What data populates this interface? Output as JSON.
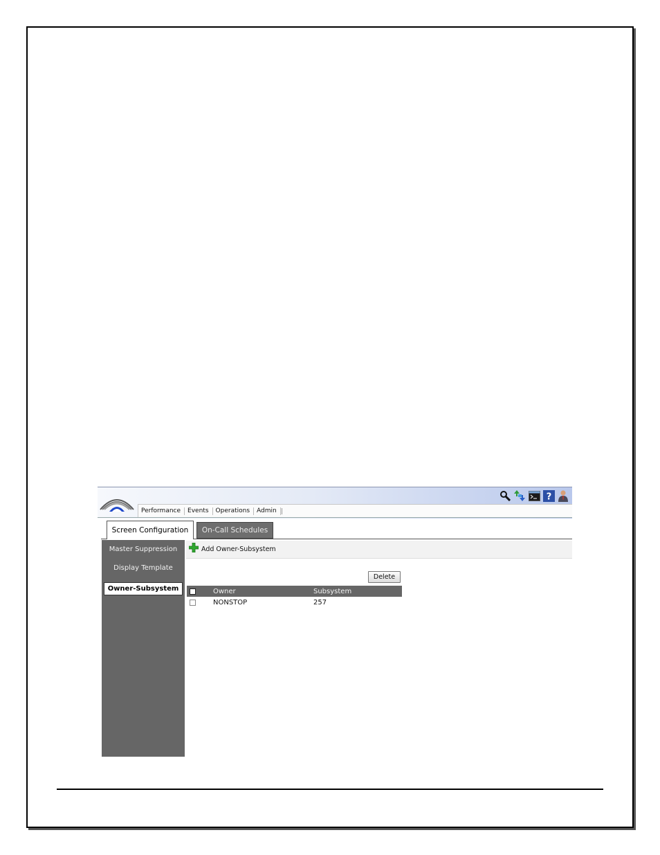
{
  "menu": {
    "items": [
      "Performance",
      "Events",
      "Operations",
      "Admin"
    ]
  },
  "top_icons": [
    "search-icon",
    "refresh-arrows-icon",
    "terminal-icon",
    "help-icon",
    "user-icon"
  ],
  "tabs": [
    {
      "label": "Screen Configuration",
      "active": true
    },
    {
      "label": "On-Call Schedules",
      "active": false
    }
  ],
  "sidebar": {
    "items": [
      {
        "label": "Master Suppression",
        "active": false
      },
      {
        "label": "Display Template",
        "active": false
      },
      {
        "label": "Owner-Subsystem",
        "active": true
      }
    ]
  },
  "toolbar": {
    "add_label": "Add Owner-Subsystem"
  },
  "actions": {
    "delete_label": "Delete"
  },
  "table": {
    "headers": [
      "Owner",
      "Subsystem"
    ],
    "rows": [
      {
        "owner": "NONSTOP",
        "subsystem": "257"
      }
    ]
  },
  "colors": {
    "sidebar_bg": "#666666",
    "header_gradient_end": "#b9c8ec",
    "add_icon": "#2fa82f"
  }
}
